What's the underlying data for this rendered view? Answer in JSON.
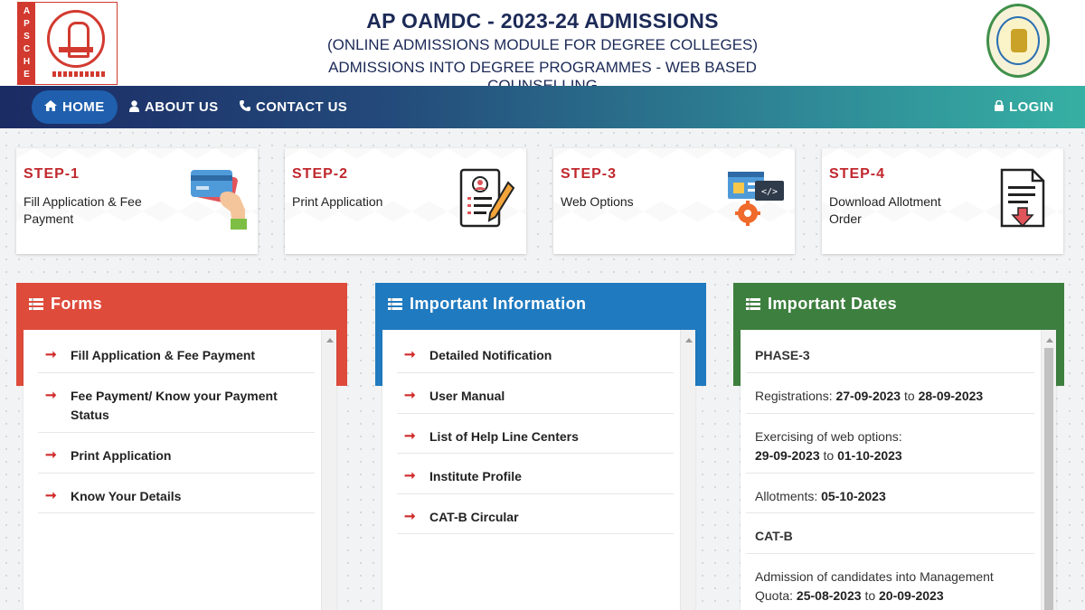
{
  "header": {
    "logo_left_text": "APSCHE",
    "title": "AP OAMDC - 2023-24 ADMISSIONS",
    "subtitle1": "(ONLINE ADMISSIONS MODULE FOR DEGREE COLLEGES)",
    "subtitle2": "ADMISSIONS INTO DEGREE PROGRAMMES - WEB BASED COUNSELLING"
  },
  "nav": {
    "items": [
      {
        "label": "HOME",
        "icon": "home-icon"
      },
      {
        "label": "ABOUT US",
        "icon": "user-icon"
      },
      {
        "label": "CONTACT US",
        "icon": "phone-icon"
      }
    ],
    "login": {
      "label": "LOGIN",
      "icon": "lock-icon"
    }
  },
  "steps": [
    {
      "num": "STEP-1",
      "label": "Fill Application & Fee Payment",
      "icon": "card-payment-icon"
    },
    {
      "num": "STEP-2",
      "label": "Print Application",
      "icon": "document-pen-icon"
    },
    {
      "num": "STEP-3",
      "label": "Web Options",
      "icon": "web-settings-icon"
    },
    {
      "num": "STEP-4",
      "label": "Download Allotment Order",
      "icon": "download-document-icon"
    }
  ],
  "panels": {
    "forms": {
      "title": "Forms",
      "color": "#de4b3b",
      "items": [
        "Fill Application & Fee Payment",
        "Fee Payment/ Know your Payment Status",
        "Print Application",
        "Know Your Details"
      ]
    },
    "info": {
      "title": "Important Information",
      "color": "#1f7ac0",
      "items": [
        "Detailed Notification",
        "User Manual",
        "List of Help Line Centers",
        "Institute Profile",
        "CAT-B Circular"
      ]
    },
    "dates": {
      "title": "Important Dates",
      "color": "#3d7f3f",
      "phase3": "PHASE-3",
      "reg_label": "Registrations:",
      "reg_from": "27-09-2023",
      "to": "to",
      "reg_to": "28-09-2023",
      "web_label": "Exercising of web options:",
      "web_from": "29-09-2023",
      "web_to": "01-10-2023",
      "allot_label": "Allotments:",
      "allot_date": "05-10-2023",
      "catb": "CAT-B",
      "mgmt_label": "Admission of candidates into Management Quota:",
      "mgmt_from": "25-08-2023",
      "mgmt_to": "20-09-2023"
    }
  }
}
